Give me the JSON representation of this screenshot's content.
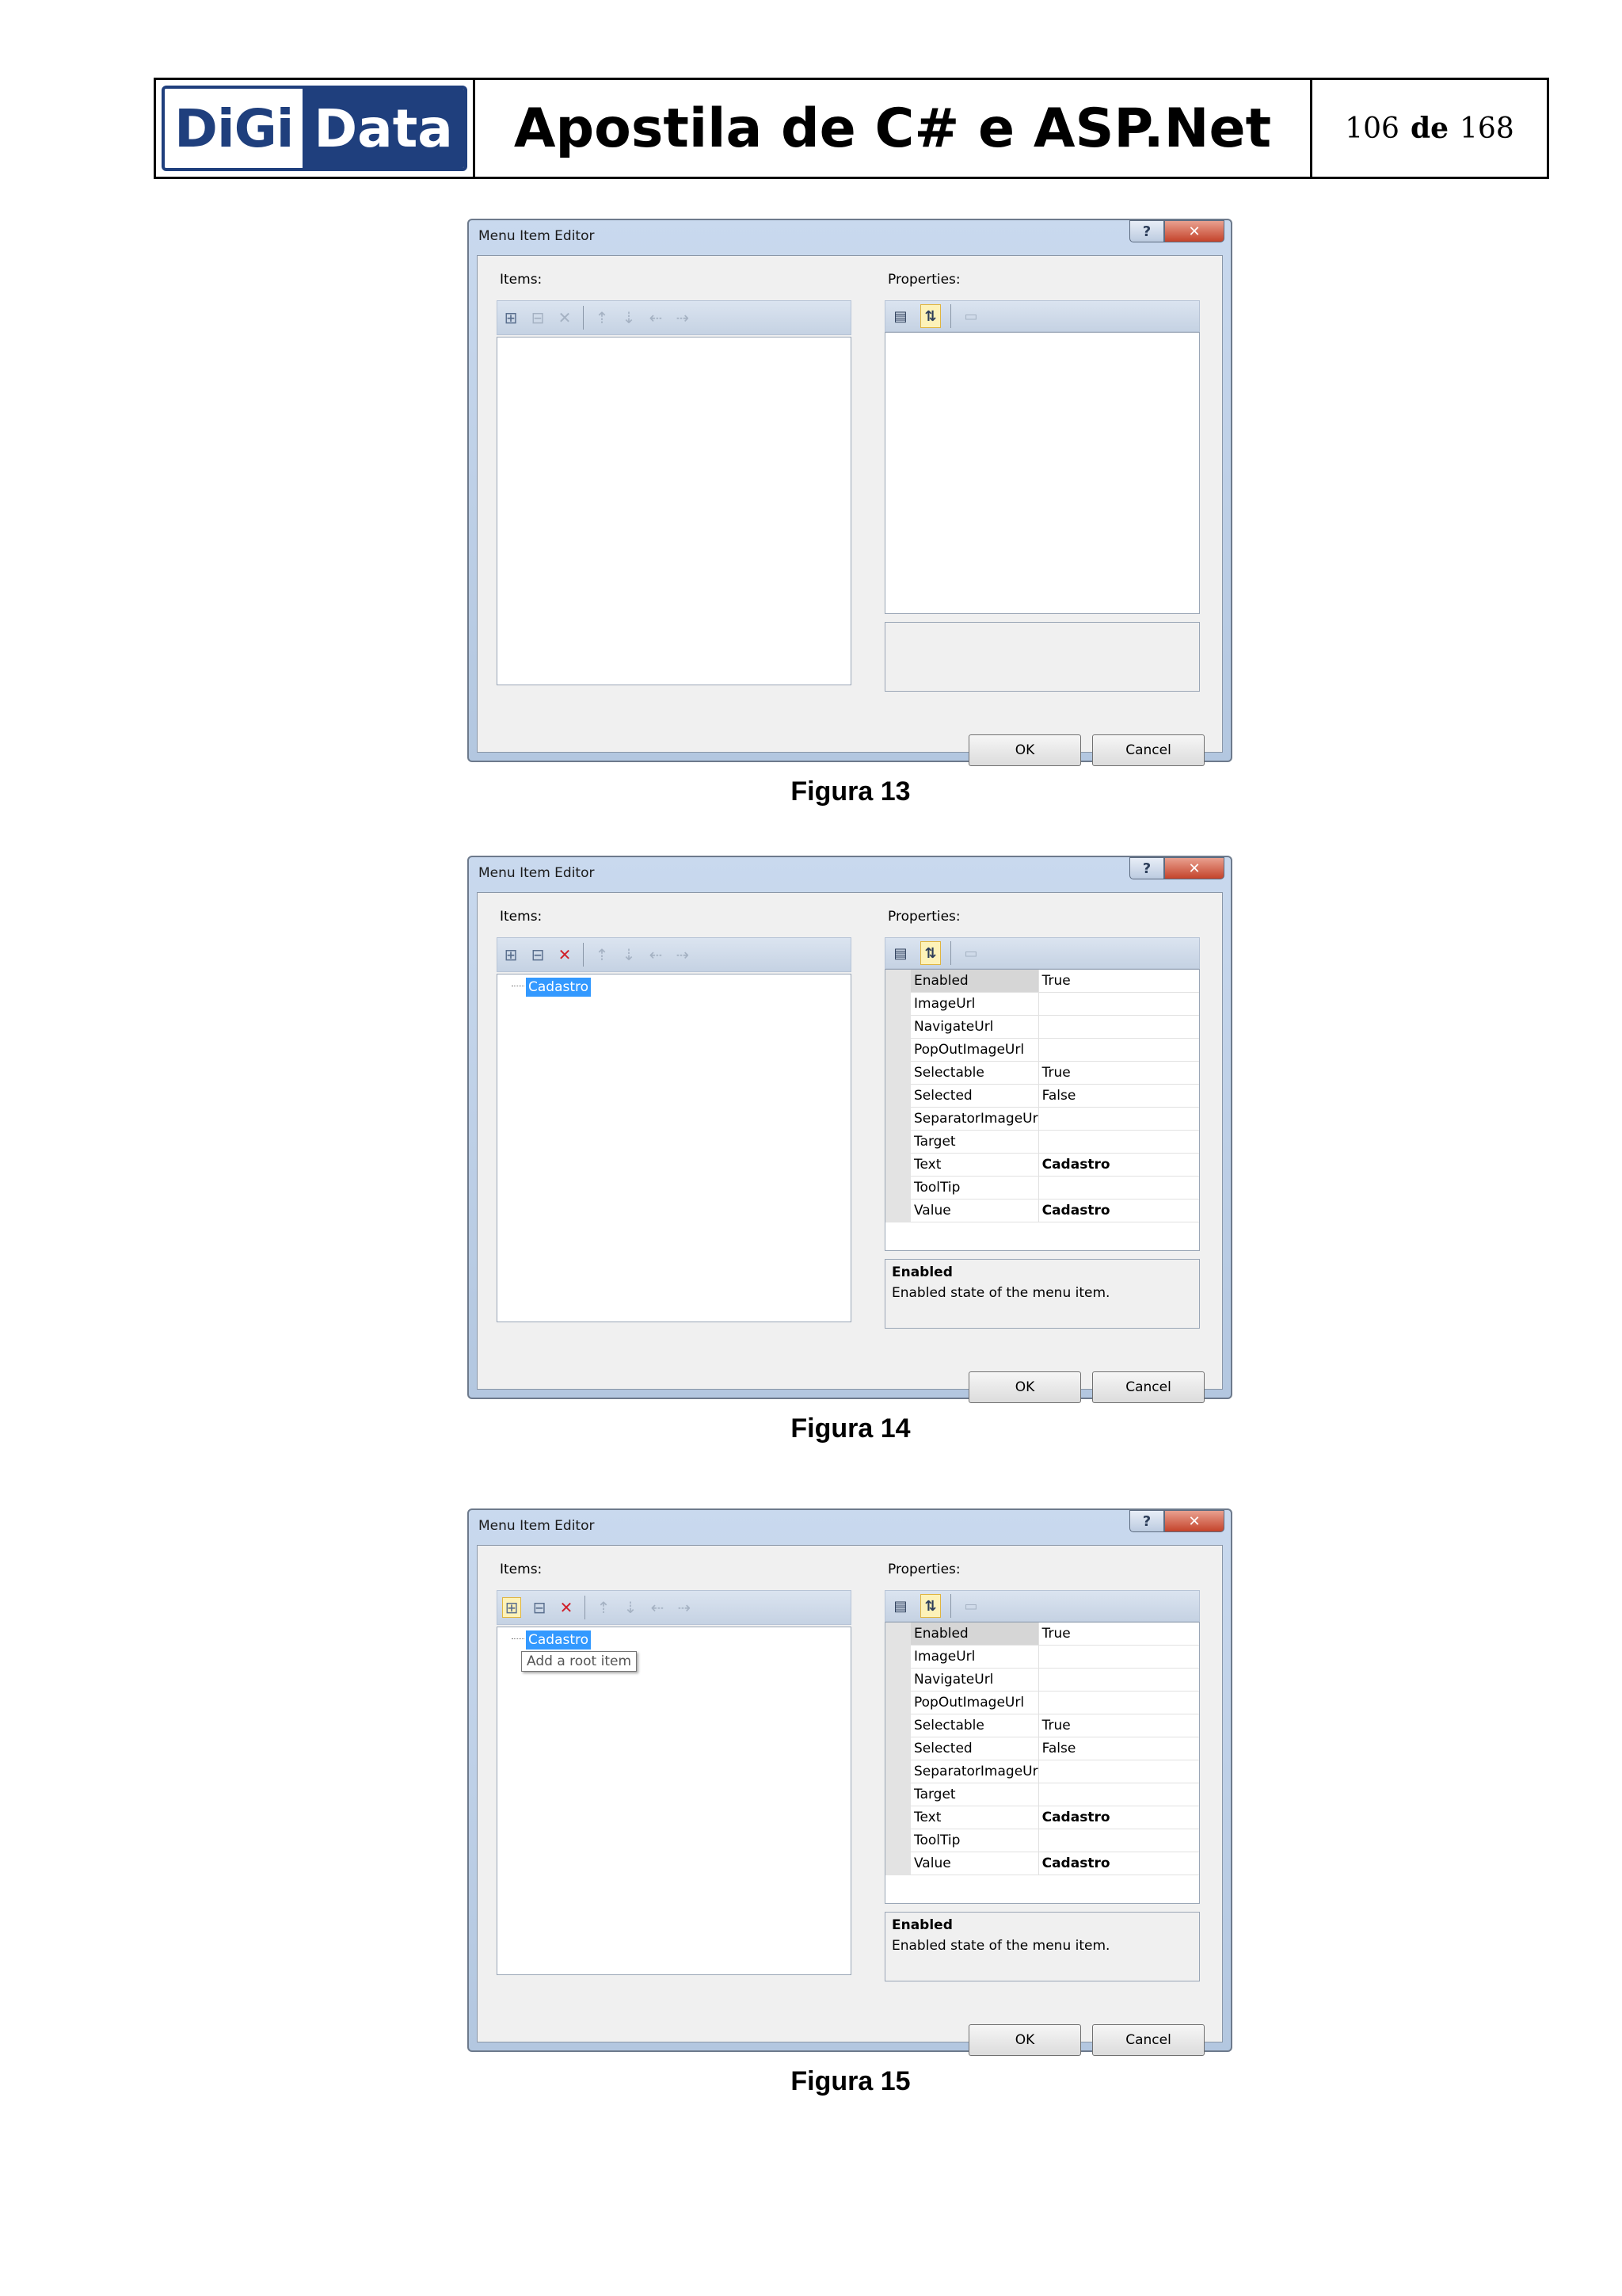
{
  "header": {
    "logo_left": "DiGi",
    "logo_right": "Data",
    "title": "Apostila de C# e ASP.Net",
    "page_current": "106",
    "page_sep": "de",
    "page_total": "168"
  },
  "dialog": {
    "title": "Menu Item Editor",
    "help_glyph": "?",
    "close_glyph": "✕",
    "items_label": "Items:",
    "properties_label": "Properties:",
    "ok_label": "OK",
    "cancel_label": "Cancel",
    "tree_node": "Cadastro",
    "tooltip": "Add a root item",
    "description_title": "Enabled",
    "description_text": "Enabled state of the menu item.",
    "properties": [
      {
        "name": "Enabled",
        "value": "True"
      },
      {
        "name": "ImageUrl",
        "value": ""
      },
      {
        "name": "NavigateUrl",
        "value": ""
      },
      {
        "name": "PopOutImageUrl",
        "value": ""
      },
      {
        "name": "Selectable",
        "value": "True"
      },
      {
        "name": "Selected",
        "value": "False"
      },
      {
        "name": "SeparatorImageUr",
        "value": ""
      },
      {
        "name": "Target",
        "value": ""
      },
      {
        "name": "Text",
        "value": "Cadastro"
      },
      {
        "name": "ToolTip",
        "value": ""
      },
      {
        "name": "Value",
        "value": "Cadastro"
      }
    ]
  },
  "captions": [
    "Figura 13",
    "Figura 14",
    "Figura 15"
  ]
}
